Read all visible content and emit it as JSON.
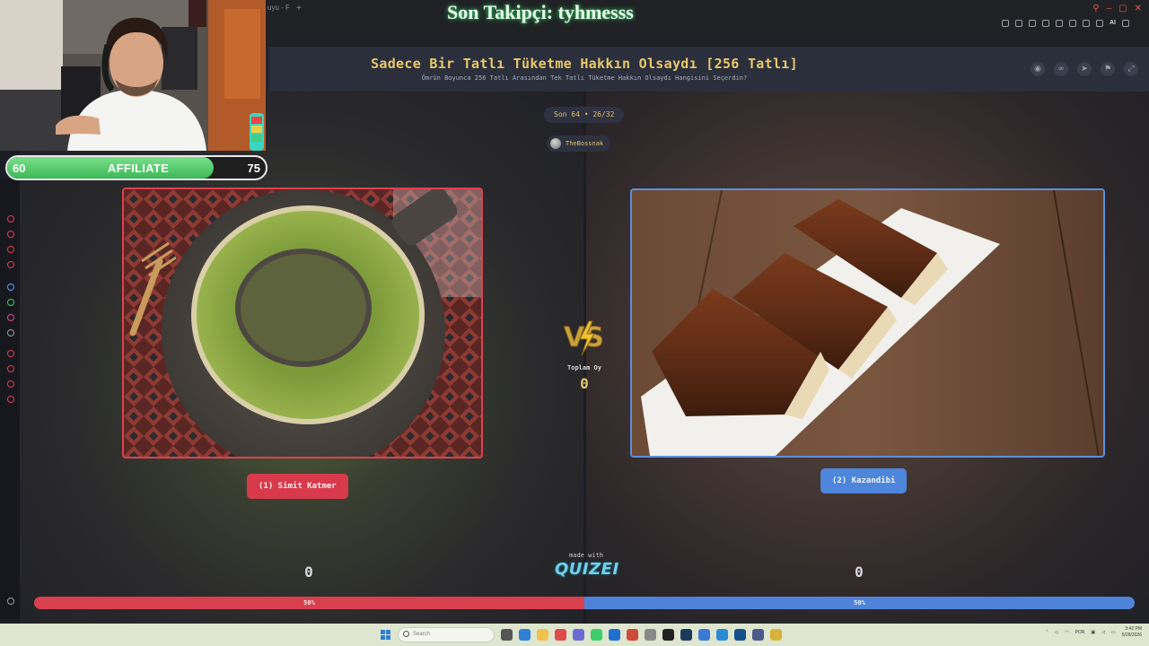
{
  "overlay": {
    "last_follower": "Son Takipçi: tyhmesss",
    "affiliate_label": "AFFILIATE",
    "affiliate_current": "60",
    "affiliate_goal": "75",
    "affiliate_progress": 0.8
  },
  "browser": {
    "tab_text": "uyu - F",
    "new_tab": "+",
    "extension_ai": "AI"
  },
  "app": {
    "title": "Sadece Bir Tatlı Tüketme Hakkın Olsaydı [256 Tatlı]",
    "subtitle": "Ömrün Boyunca 256 Tatlı Arasından Tek Tatlı Tüketme Hakkın Olsaydı Hangisini Seçerdin?",
    "round": "Son 64 • 26/32",
    "author": "TheBossnak",
    "header_icons": [
      "eye-icon",
      "link-icon",
      "send-icon",
      "flag-icon",
      "expand-icon"
    ],
    "vs_label": "VS",
    "total_votes_label": "Toplam Oy",
    "total_votes_value": "0",
    "left_option": {
      "label": "(1) Simit Katmer",
      "votes": "0",
      "percent_label": "50%",
      "percent": 50,
      "color": "#d8404e"
    },
    "right_option": {
      "label": "(2) Kazandibi",
      "votes": "0",
      "percent_label": "50%",
      "percent": 50,
      "color": "#4f83d9"
    },
    "made_with": "made with",
    "brand": "QUIZEI"
  },
  "taskbar": {
    "search_placeholder": "Search",
    "lang": "POR",
    "time": "3:42 PM",
    "date": "5/28/2026"
  }
}
